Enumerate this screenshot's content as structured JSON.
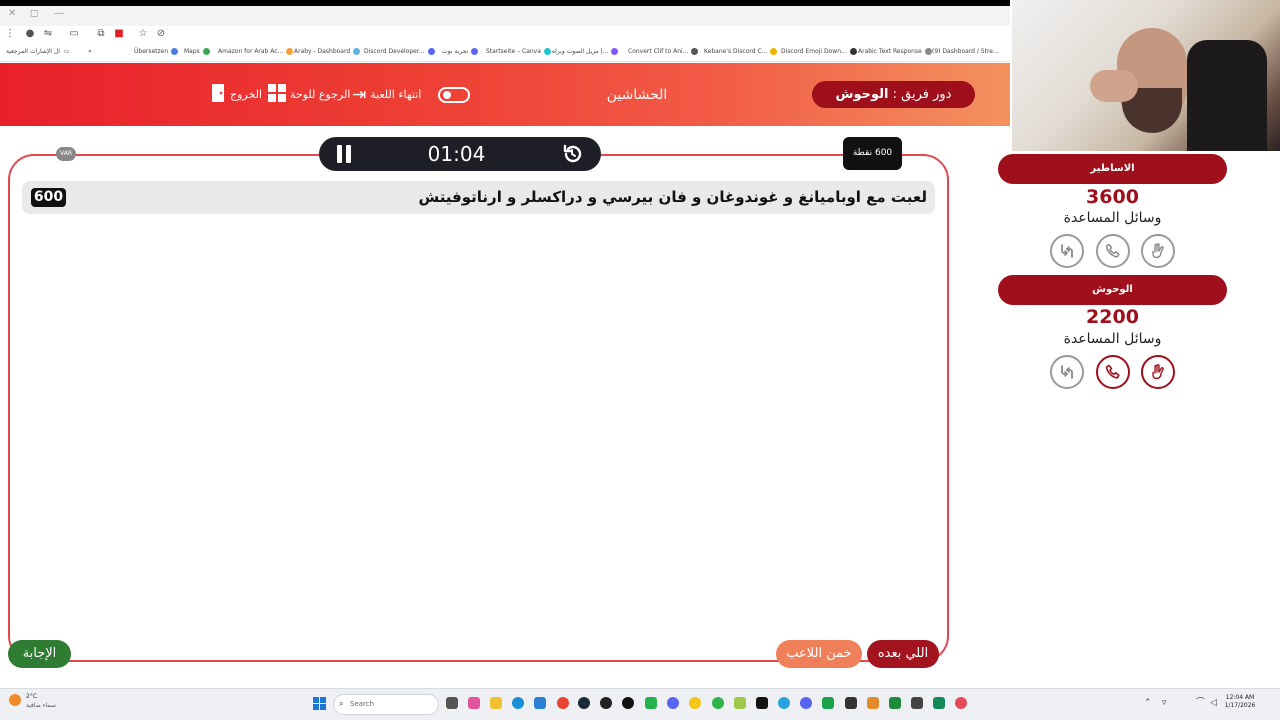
{
  "header": {
    "turn_prefix": "دور فريق :",
    "turn_team": "الوحوش",
    "game_name": "الحشاشين",
    "end_game_label": "انتهاء اللعبة",
    "back_to_board_label": "الرجوع للوحة",
    "exit_label": "الخروج"
  },
  "board": {
    "var_label": "VAR",
    "timer": "01:04",
    "points_tag": "600 نقطة",
    "question": "لعبت مع اوباميانغ و غوندوغان و فان بيرسي و دراكسلر و ارناتوفيتش",
    "question_points": "600",
    "answer_button": "الإجابة",
    "guess_button": "خمن اللاعب",
    "next_button": "اللي بعده"
  },
  "teams": [
    {
      "name": "الاساطير",
      "score": "3600",
      "aids_label": "وسائل المساعدة"
    },
    {
      "name": "الوحوش",
      "score": "2200",
      "aids_label": "وسائل المساعدة"
    }
  ],
  "bookmarks": [
    "ال الإشارات المرجعية",
    "Übersetzen",
    "Maps",
    "Amazon for Arab Ac...",
    "Araby - Dashboard",
    "Discord Developer...",
    "تجربة بوت",
    "Startseite – Canva",
    "مزيل الصوت وبراه |...",
    "Convert Clif to Ani...",
    "Kebane's Discord C...",
    "Discord Emoji Down...",
    "Arabic Text Response",
    "(9) Dashboard / Stre..."
  ],
  "taskbar": {
    "temperature": "2°C",
    "weather": "سماء صافية",
    "search_placeholder": "Search",
    "time": "12:04 AM",
    "date": "1/17/2026"
  },
  "colors": {
    "accent_red": "#a0101c",
    "header_start": "#e8202a",
    "header_end": "#f3925f",
    "answer_green": "#2e7d32",
    "guess_orange": "#f0805a"
  }
}
